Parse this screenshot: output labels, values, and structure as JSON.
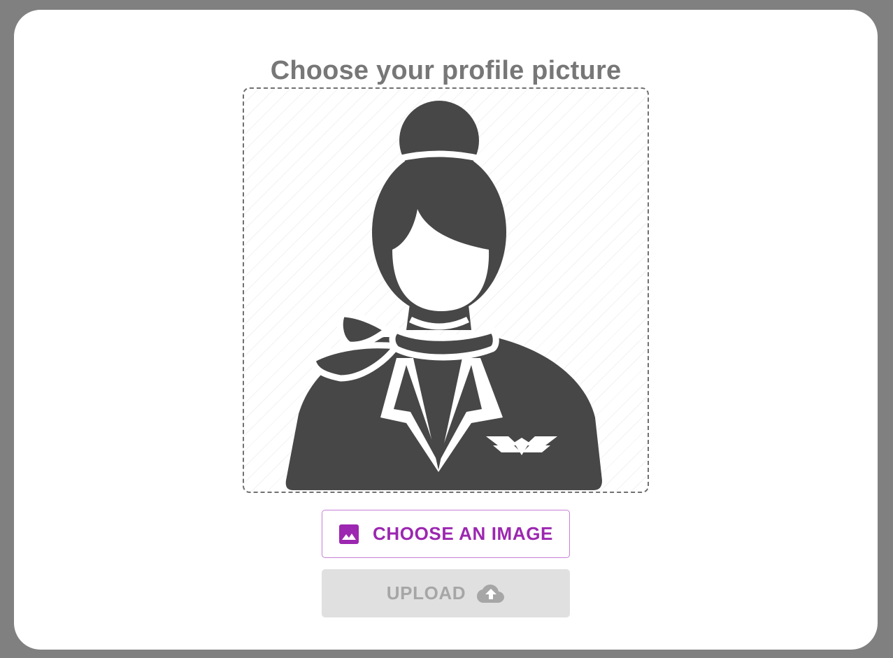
{
  "page": {
    "title": "Choose your profile picture"
  },
  "preview": {
    "image_icon": "flight-attendant-avatar-icon"
  },
  "buttons": {
    "choose_label": "CHOOSE AN IMAGE",
    "choose_icon": "image-icon",
    "upload_label": "UPLOAD",
    "upload_icon": "cloud-upload-icon",
    "upload_disabled": true
  },
  "colors": {
    "accent": "#9c27b0",
    "disabled_text": "#a6a6a6",
    "disabled_bg": "#e0e0e0",
    "frame": "#808080"
  }
}
